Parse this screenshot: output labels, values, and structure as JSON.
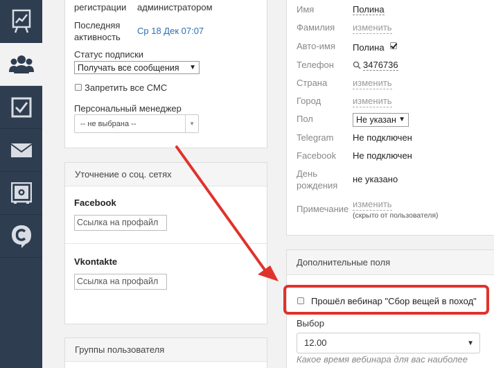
{
  "sidebar": {
    "items": [
      {
        "icon": "chart-board-icon"
      },
      {
        "icon": "users-icon",
        "active": true
      },
      {
        "icon": "checkbox-icon"
      },
      {
        "icon": "mail-icon"
      },
      {
        "icon": "safe-icon"
      },
      {
        "icon": "chat-c-icon"
      }
    ]
  },
  "left_panel": {
    "registration_label": "регистрации",
    "registration_value": "администратором",
    "last_activity_label_1": "Последняя",
    "last_activity_label_2": "активность",
    "last_activity_value": "Ср 18 Дек 07:07",
    "subscription_status_label": "Статус подписки",
    "subscription_status_value": "Получать все сообщения",
    "block_sms_label": "Запретить все СМС",
    "manager_label": "Персональный менеджер",
    "manager_value": "-- не выбрана --"
  },
  "social_panel": {
    "title": "Уточнение о соц. сетях",
    "facebook_label": "Facebook",
    "facebook_placeholder": "Ссылка на профайл",
    "vk_label": "Vkontakte",
    "vk_placeholder": "Ссылка на профайл"
  },
  "groups_panel": {
    "title": "Группы пользователя"
  },
  "profile": {
    "fields": [
      {
        "label": "Имя",
        "value": "Полина"
      },
      {
        "label": "Фамилия",
        "value": "изменить"
      },
      {
        "label": "Авто-имя",
        "value": "Полина"
      },
      {
        "label": "Телефон",
        "value": "3476736"
      },
      {
        "label": "Страна",
        "value": "изменить"
      },
      {
        "label": "Город",
        "value": "изменить"
      },
      {
        "label": "Пол",
        "value": "Не указан"
      },
      {
        "label": "Telegram",
        "value": "Не подключен"
      },
      {
        "label": "Facebook",
        "value": "Не подключен"
      },
      {
        "label_1": "День",
        "label_2": "рождения",
        "value": "не указано"
      },
      {
        "label": "Примечание",
        "value": "изменить",
        "note": "(скрыто от пользователя)"
      }
    ]
  },
  "extra_fields": {
    "title": "Дополнительные поля",
    "webinar_checkbox_label": "Прошёл вебинар \"Сбор вещей в поход\"",
    "choice_label": "Выбор",
    "choice_value": "12.00",
    "choice_hint": "Какое время вебинара для вас наиболее"
  },
  "colors": {
    "sidebar_bg": "#2e3d50",
    "link": "#2a6fb5",
    "highlight": "#e0322c"
  }
}
